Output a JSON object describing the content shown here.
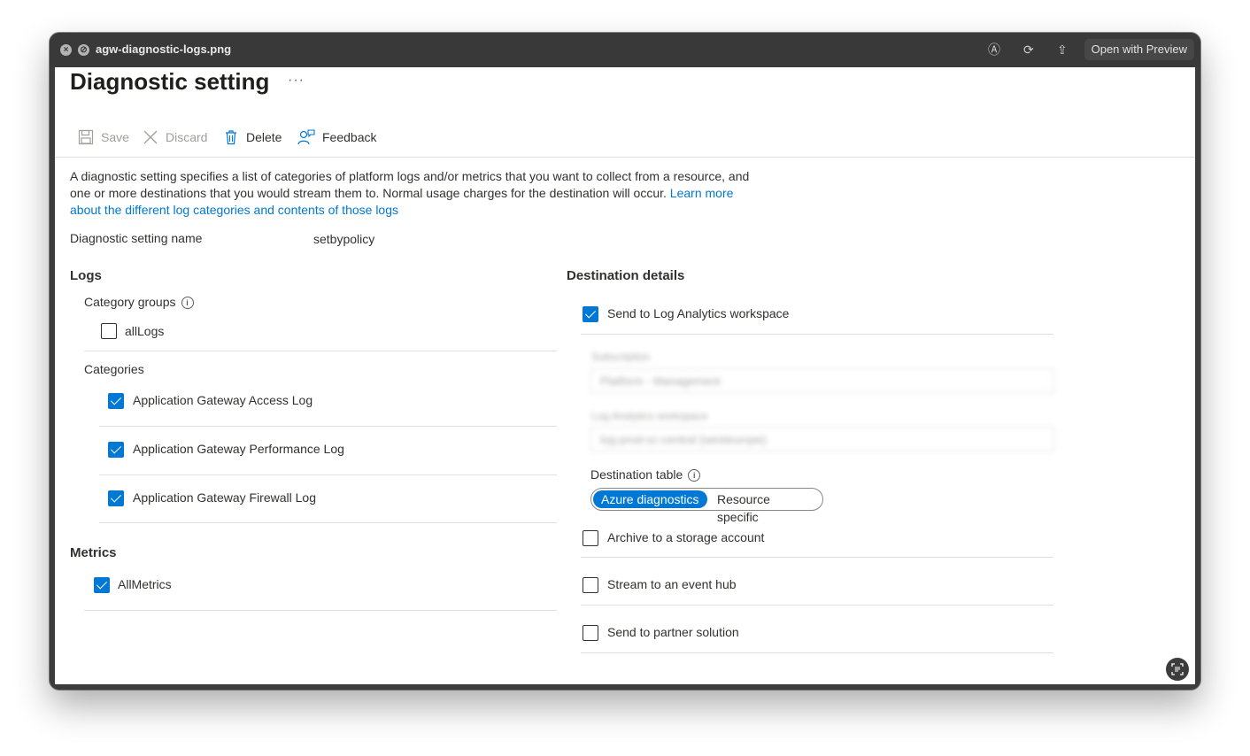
{
  "window": {
    "title": "agw-diagnostic-logs.png",
    "open_with_label": "Open with Preview"
  },
  "page": {
    "title": "Diagnostic setting",
    "more_label": "···"
  },
  "toolbar": {
    "save_label": "Save",
    "discard_label": "Discard",
    "delete_label": "Delete",
    "feedback_label": "Feedback"
  },
  "description": {
    "text": "A diagnostic setting specifies a list of categories of platform logs and/or metrics that you want to collect from a resource, and one or more destinations that you would stream them to. Normal usage charges for the destination will occur.",
    "link_text": "Learn more about the different log categories and contents of those logs"
  },
  "setting_name": {
    "label": "Diagnostic setting name",
    "value": "setbypolicy"
  },
  "logs": {
    "heading": "Logs",
    "category_groups_label": "Category groups",
    "groups": [
      {
        "label": "allLogs",
        "checked": false
      }
    ],
    "categories_label": "Categories",
    "categories": [
      {
        "label": "Application Gateway Access Log",
        "checked": true
      },
      {
        "label": "Application Gateway Performance Log",
        "checked": true
      },
      {
        "label": "Application Gateway Firewall Log",
        "checked": true
      }
    ]
  },
  "metrics": {
    "heading": "Metrics",
    "items": [
      {
        "label": "AllMetrics",
        "checked": true
      }
    ]
  },
  "destination": {
    "heading": "Destination details",
    "log_analytics": {
      "label": "Send to Log Analytics workspace",
      "checked": true
    },
    "subscription_label": "Subscription",
    "subscription_value": "Platform - Management",
    "workspace_label": "Log Analytics workspace",
    "workspace_value": "log-prod-sc-central (westeurope)",
    "destination_table_label": "Destination table",
    "table_options": [
      "Azure diagnostics",
      "Resource specific"
    ],
    "table_selected": "Azure diagnostics",
    "storage": {
      "label": "Archive to a storage account",
      "checked": false
    },
    "event_hub": {
      "label": "Stream to an event hub",
      "checked": false
    },
    "partner": {
      "label": "Send to partner solution",
      "checked": false
    }
  },
  "colors": {
    "accent": "#0078d4",
    "titlebar": "#393939"
  }
}
